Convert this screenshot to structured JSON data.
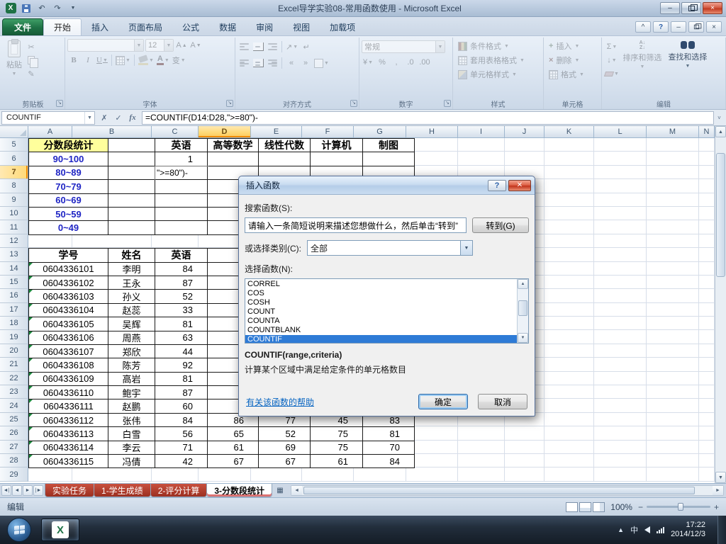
{
  "titlebar": {
    "title": "Excel导学实验08-常用函数使用 - Microsoft Excel"
  },
  "icons": {
    "undo": "↶",
    "redo": "↷",
    "qat_dropdown": "▼",
    "cut": "✂",
    "sum": "Σ",
    "fill": "↓",
    "cancel": "✗",
    "enter": "✓",
    "insert_function": "fx",
    "name_box_dropdown": "▼",
    "minimize": "–",
    "close": "×",
    "ribbon_collapse": "^",
    "help": "?",
    "dialog_close": "✕",
    "scroll_up": "▲",
    "scroll_down": "▼",
    "scroll_left": "◄",
    "scroll_right": "►",
    "tray_expand": "▲",
    "zoom_out": "−",
    "zoom_in": "+"
  },
  "ribbon": {
    "file_tab": "文件",
    "tabs": [
      "开始",
      "插入",
      "页面布局",
      "公式",
      "数据",
      "审阅",
      "视图",
      "加载项"
    ],
    "active_tab": "开始",
    "clipboard": {
      "label": "剪贴板",
      "paste": "粘贴"
    },
    "font": {
      "label": "字体",
      "font_name": "",
      "font_size": "12",
      "bold": "B",
      "italic": "I",
      "underline": "U"
    },
    "alignment": {
      "label": "对齐方式"
    },
    "number": {
      "label": "数字",
      "format": "常规",
      "currency": "¥",
      "percent": "%",
      "comma": ",",
      "dec1": ".0",
      "dec2": ".00"
    },
    "styles": {
      "label": "样式",
      "conditional": "条件格式",
      "table_format": "套用表格格式",
      "cell_styles": "单元格样式"
    },
    "cells": {
      "label": "单元格",
      "insert": "插入",
      "delete": "删除",
      "format": "格式"
    },
    "editing": {
      "label": "编辑",
      "sort": "排序和筛选",
      "find": "查找和选择"
    }
  },
  "formula_bar": {
    "name_box": "COUNTIF",
    "formula": "=COUNTIF(D14:D28,\">=80\")-"
  },
  "grid": {
    "columns": [
      "A",
      "B",
      "C",
      "D",
      "E",
      "F",
      "G",
      "H",
      "I",
      "J",
      "K",
      "L",
      "M",
      "N"
    ],
    "rows": [
      5,
      6,
      7,
      8,
      9,
      10,
      11,
      12,
      13,
      14,
      15,
      16,
      17,
      18,
      19,
      20,
      21,
      22,
      23,
      24,
      25,
      26,
      27,
      28,
      29
    ],
    "selected_column": "D",
    "selected_row": 7
  },
  "sheet": {
    "stats": {
      "title": "分数段统计",
      "col_headers": [
        "英语",
        "高等数学",
        "线性代数",
        "计算机",
        "制图"
      ],
      "row_labels": [
        "90~100",
        "80~89",
        "70~79",
        "60~69",
        "50~59",
        "0~49"
      ],
      "count_90_100": "1",
      "editing_cell_text": "\">=80\")-"
    },
    "students": {
      "headers": [
        "学号",
        "姓名",
        "英语"
      ],
      "rows": [
        {
          "id": "0604336101",
          "name": "李明",
          "scores": [
            "84"
          ]
        },
        {
          "id": "0604336102",
          "name": "王永",
          "scores": [
            "87"
          ]
        },
        {
          "id": "0604336103",
          "name": "孙义",
          "scores": [
            "52"
          ]
        },
        {
          "id": "0604336104",
          "name": "赵蕊",
          "scores": [
            "33"
          ]
        },
        {
          "id": "0604336105",
          "name": "吴辉",
          "scores": [
            "81"
          ]
        },
        {
          "id": "0604336106",
          "name": "周燕",
          "scores": [
            "63"
          ]
        },
        {
          "id": "0604336107",
          "name": "郑欣",
          "scores": [
            "44"
          ]
        },
        {
          "id": "0604336108",
          "name": "陈芳",
          "scores": [
            "92"
          ]
        },
        {
          "id": "0604336109",
          "name": "高岩",
          "scores": [
            "81"
          ]
        },
        {
          "id": "0604336110",
          "name": "鲍宇",
          "scores": [
            "87"
          ]
        },
        {
          "id": "0604336111",
          "name": "赵鹏",
          "scores": [
            "60"
          ]
        },
        {
          "id": "0604336112",
          "name": "张伟",
          "scores": [
            "84",
            "86",
            "77",
            "45",
            "83"
          ]
        },
        {
          "id": "0604336113",
          "name": "白雪",
          "scores": [
            "56",
            "65",
            "52",
            "75",
            "81"
          ]
        },
        {
          "id": "0604336114",
          "name": "李云",
          "scores": [
            "71",
            "61",
            "69",
            "75",
            "70"
          ]
        },
        {
          "id": "0604336115",
          "name": "冯倩",
          "scores": [
            "42",
            "67",
            "67",
            "61",
            "84"
          ]
        }
      ]
    }
  },
  "dialog": {
    "title": "插入函数",
    "search_label": "搜索函数(S):",
    "search_text": "请输入一条简短说明来描述您想做什么，然后单击“转到”",
    "go_button": "转到(G)",
    "category_label": "或选择类别(C):",
    "category_value": "全部",
    "select_label": "选择函数(N):",
    "functions": [
      "CORREL",
      "COS",
      "COSH",
      "COUNT",
      "COUNTA",
      "COUNTBLANK",
      "COUNTIF"
    ],
    "selected_function": "COUNTIF",
    "signature": "COUNTIF(range,criteria)",
    "description": "计算某个区域中满足给定条件的单元格数目",
    "help_link": "有关该函数的帮助",
    "ok": "确定",
    "cancel": "取消"
  },
  "sheet_tabs": {
    "tabs": [
      "实验任务",
      "1-学生成绩",
      "2-评分计算",
      "3-分数段统计"
    ],
    "active": "3-分数段统计"
  },
  "status_bar": {
    "mode": "编辑",
    "zoom": "100%"
  },
  "taskbar": {
    "time": "17:22",
    "date": "2014/12/3"
  }
}
